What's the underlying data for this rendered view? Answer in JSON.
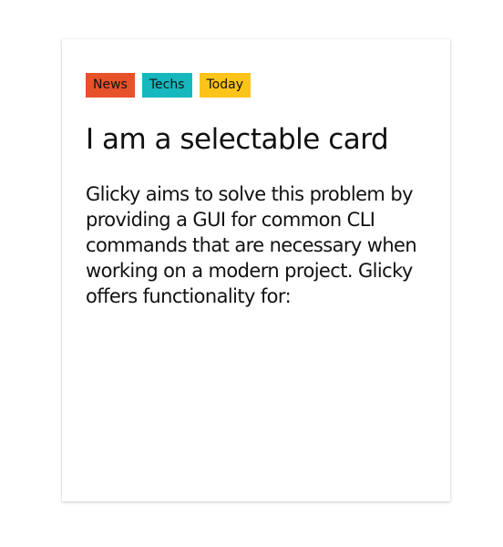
{
  "card": {
    "tags": [
      {
        "label": "News",
        "color": "#e8522a"
      },
      {
        "label": "Techs",
        "color": "#16b8be"
      },
      {
        "label": "Today",
        "color": "#fcc419"
      }
    ],
    "title": "I am a selectable card",
    "body": "Glicky aims to solve this problem by providing a GUI for common CLI commands that are necessary when working on a modern project. Glicky offers functionality for:"
  }
}
